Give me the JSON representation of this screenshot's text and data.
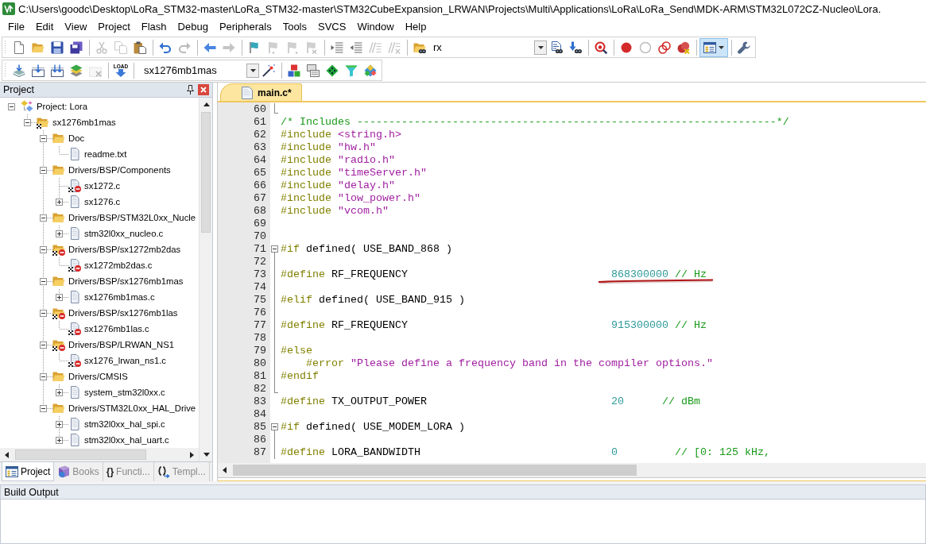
{
  "window": {
    "title": "C:\\Users\\goodc\\Desktop\\LoRa_STM32-master\\LoRa_STM32-master\\STM32CubeExpansion_LRWAN\\Projects\\Multi\\Applications\\LoRa\\LoRa_Send\\MDK-ARM\\STM32L072CZ-Nucleo\\Lora."
  },
  "menu": [
    "File",
    "Edit",
    "View",
    "Project",
    "Flash",
    "Debug",
    "Peripherals",
    "Tools",
    "SVCS",
    "Window",
    "Help"
  ],
  "toolbars": [
    {
      "items": [
        {
          "kind": "new",
          "disabled": false
        },
        {
          "kind": "open",
          "disabled": false
        },
        {
          "kind": "save",
          "disabled": false
        },
        {
          "kind": "save-all",
          "disabled": false
        },
        {
          "kind": "separator"
        },
        {
          "kind": "cut",
          "disabled": true
        },
        {
          "kind": "copy",
          "disabled": true
        },
        {
          "kind": "paste",
          "disabled": false
        },
        {
          "kind": "separator"
        },
        {
          "kind": "undo",
          "disabled": false
        },
        {
          "kind": "redo",
          "disabled": true
        },
        {
          "kind": "separator"
        },
        {
          "kind": "back",
          "disabled": false
        },
        {
          "kind": "forward",
          "disabled": true
        },
        {
          "kind": "separator"
        },
        {
          "kind": "bookmark",
          "disabled": false
        },
        {
          "kind": "bookmark-prev",
          "disabled": true
        },
        {
          "kind": "bookmark-next",
          "disabled": true
        },
        {
          "kind": "bookmark-clear",
          "disabled": true
        },
        {
          "kind": "separator"
        },
        {
          "kind": "indent",
          "disabled": false
        },
        {
          "kind": "unindent",
          "disabled": false
        },
        {
          "kind": "comment",
          "disabled": true
        },
        {
          "kind": "uncomment",
          "disabled": true
        },
        {
          "kind": "separator"
        },
        {
          "kind": "find-in-files",
          "disabled": false
        },
        {
          "kind": "find-combo",
          "value": "rx"
        },
        {
          "kind": "find",
          "disabled": false
        },
        {
          "kind": "find-incremental",
          "disabled": false
        },
        {
          "kind": "separator"
        },
        {
          "kind": "debug",
          "disabled": false
        },
        {
          "kind": "separator"
        },
        {
          "kind": "breakpoint",
          "disabled": false
        },
        {
          "kind": "breakpoint-disable",
          "disabled": false
        },
        {
          "kind": "breakpoints-disable-all",
          "disabled": false
        },
        {
          "kind": "breakpoints-kill",
          "disabled": false
        },
        {
          "kind": "separator"
        },
        {
          "kind": "window-layout",
          "pressed": true
        },
        {
          "kind": "separator"
        },
        {
          "kind": "configure",
          "disabled": false
        }
      ]
    },
    {
      "items": [
        {
          "kind": "translate",
          "disabled": false
        },
        {
          "kind": "build",
          "disabled": false
        },
        {
          "kind": "rebuild",
          "disabled": false
        },
        {
          "kind": "batch-build",
          "disabled": false
        },
        {
          "kind": "stop-build",
          "disabled": true
        },
        {
          "kind": "separator"
        },
        {
          "kind": "load",
          "label": "LOAD"
        },
        {
          "kind": "separator"
        },
        {
          "kind": "target-combo",
          "value": "sx1276mb1mas"
        },
        {
          "kind": "target-options",
          "disabled": false
        },
        {
          "kind": "separator"
        },
        {
          "kind": "components",
          "disabled": false
        },
        {
          "kind": "environment",
          "disabled": false
        },
        {
          "kind": "packs",
          "disabled": false
        },
        {
          "kind": "filter",
          "disabled": false
        },
        {
          "kind": "pack-installer",
          "disabled": false
        }
      ]
    }
  ],
  "project_panel": {
    "title": "Project",
    "tree": [
      {
        "kind": "project",
        "label": "Project: Lora",
        "expanded": true,
        "children": [
          {
            "kind": "target",
            "label": "sx1276mb1mas",
            "expanded": true,
            "children": [
              {
                "kind": "group",
                "label": "Doc",
                "expanded": true,
                "excluded": false,
                "children": [
                  {
                    "kind": "file",
                    "label": "readme.txt",
                    "excluded": false
                  }
                ]
              },
              {
                "kind": "group",
                "label": "Drivers/BSP/Components",
                "expanded": true,
                "excluded": false,
                "children": [
                  {
                    "kind": "file",
                    "label": "sx1272.c",
                    "excluded": true
                  },
                  {
                    "kind": "file",
                    "label": "sx1276.c",
                    "expanded": false,
                    "excluded": false
                  }
                ]
              },
              {
                "kind": "group",
                "label": "Drivers/BSP/STM32L0xx_Nucle",
                "expanded": true,
                "excluded": false,
                "children": [
                  {
                    "kind": "file",
                    "label": "stm32l0xx_nucleo.c",
                    "expanded": false,
                    "excluded": false
                  }
                ]
              },
              {
                "kind": "group",
                "label": "Drivers/BSP/sx1272mb2das",
                "expanded": true,
                "excluded": true,
                "children": [
                  {
                    "kind": "file",
                    "label": "sx1272mb2das.c",
                    "excluded": true
                  }
                ]
              },
              {
                "kind": "group",
                "label": "Drivers/BSP/sx1276mb1mas",
                "expanded": true,
                "excluded": false,
                "children": [
                  {
                    "kind": "file",
                    "label": "sx1276mb1mas.c",
                    "expanded": false,
                    "excluded": false
                  }
                ]
              },
              {
                "kind": "group",
                "label": "Drivers/BSP/sx1276mb1las",
                "expanded": true,
                "excluded": true,
                "children": [
                  {
                    "kind": "file",
                    "label": "sx1276mb1las.c",
                    "excluded": true
                  }
                ]
              },
              {
                "kind": "group",
                "label": "Drivers/BSP/LRWAN_NS1",
                "expanded": true,
                "excluded": true,
                "children": [
                  {
                    "kind": "file",
                    "label": "sx1276_lrwan_ns1.c",
                    "excluded": true
                  }
                ]
              },
              {
                "kind": "group",
                "label": "Drivers/CMSIS",
                "expanded": true,
                "excluded": false,
                "children": [
                  {
                    "kind": "file",
                    "label": "system_stm32l0xx.c",
                    "expanded": false,
                    "excluded": false
                  }
                ]
              },
              {
                "kind": "group",
                "label": "Drivers/STM32L0xx_HAL_Drive",
                "expanded": true,
                "excluded": false,
                "children": [
                  {
                    "kind": "file",
                    "label": "stm32l0xx_hal_spi.c",
                    "expanded": false,
                    "excluded": false
                  },
                  {
                    "kind": "file",
                    "label": "stm32l0xx_hal_uart.c",
                    "expanded": false,
                    "excluded": false
                  }
                ]
              }
            ]
          }
        ]
      }
    ],
    "tabs": [
      {
        "kind": "project",
        "label": "Project",
        "selected": true
      },
      {
        "kind": "books",
        "label": "Books",
        "selected": false
      },
      {
        "kind": "functions",
        "glyph": "{}",
        "label": "Functi...",
        "selected": false
      },
      {
        "kind": "templates",
        "label": "Templ...",
        "selected": false
      }
    ]
  },
  "editor": {
    "tabs": [
      {
        "label": "main.c*",
        "selected": true
      }
    ],
    "lines": [
      {
        "number": "60",
        "kind": "fold-end"
      },
      {
        "number": "61",
        "kind": "plain",
        "segments": [
          {
            "kind": "comment",
            "text": "/* Includes ------------------------------------------------------------------*/"
          }
        ]
      },
      {
        "number": "62",
        "kind": "plain",
        "segments": [
          {
            "kind": "directive",
            "text": "#include"
          },
          {
            "kind": "string",
            "text": " <string.h>"
          }
        ]
      },
      {
        "number": "63",
        "kind": "plain",
        "segments": [
          {
            "kind": "directive",
            "text": "#include"
          },
          {
            "kind": "string",
            "text": " \"hw.h\""
          }
        ]
      },
      {
        "number": "64",
        "kind": "plain",
        "segments": [
          {
            "kind": "directive",
            "text": "#include"
          },
          {
            "kind": "string",
            "text": " \"radio.h\""
          }
        ]
      },
      {
        "number": "65",
        "kind": "plain",
        "segments": [
          {
            "kind": "directive",
            "text": "#include"
          },
          {
            "kind": "string",
            "text": " \"timeServer.h\""
          }
        ]
      },
      {
        "number": "66",
        "kind": "plain",
        "segments": [
          {
            "kind": "directive",
            "text": "#include"
          },
          {
            "kind": "string",
            "text": " \"delay.h\""
          }
        ]
      },
      {
        "number": "67",
        "kind": "plain",
        "segments": [
          {
            "kind": "directive",
            "text": "#include"
          },
          {
            "kind": "string",
            "text": " \"low_power.h\""
          }
        ]
      },
      {
        "number": "68",
        "kind": "plain",
        "segments": [
          {
            "kind": "directive",
            "text": "#include"
          },
          {
            "kind": "string",
            "text": " \"vcom.h\""
          }
        ]
      },
      {
        "number": "69",
        "kind": "plain"
      },
      {
        "number": "70",
        "kind": "plain"
      },
      {
        "number": "71",
        "kind": "fold-start",
        "segments": [
          {
            "kind": "directive",
            "text": "#if"
          },
          {
            "kind": "plain",
            "text": " defined( USE_BAND_868 )"
          }
        ]
      },
      {
        "number": "72",
        "kind": "fold-inside"
      },
      {
        "number": "73",
        "kind": "fold-inside",
        "segments": [
          {
            "kind": "directive",
            "text": "#define"
          },
          {
            "kind": "plain",
            "text": " RF_FREQUENCY                                "
          }
        ],
        "underlined_segments": [
          {
            "kind": "number",
            "text": "868300000"
          },
          {
            "kind": "comment",
            "text": " // Hz"
          }
        ]
      },
      {
        "number": "74",
        "kind": "fold-inside"
      },
      {
        "number": "75",
        "kind": "fold-inside",
        "segments": [
          {
            "kind": "directive",
            "text": "#elif"
          },
          {
            "kind": "plain",
            "text": " defined( USE_BAND_915 )"
          }
        ]
      },
      {
        "number": "76",
        "kind": "fold-inside"
      },
      {
        "number": "77",
        "kind": "fold-inside",
        "segments": [
          {
            "kind": "directive",
            "text": "#define"
          },
          {
            "kind": "plain",
            "text": " RF_FREQUENCY                                "
          },
          {
            "kind": "number",
            "text": "915300000"
          },
          {
            "kind": "comment",
            "text": " // Hz"
          }
        ]
      },
      {
        "number": "78",
        "kind": "fold-inside"
      },
      {
        "number": "79",
        "kind": "fold-inside",
        "segments": [
          {
            "kind": "directive",
            "text": "#else"
          }
        ]
      },
      {
        "number": "80",
        "kind": "fold-inside",
        "segments": [
          {
            "kind": "directive",
            "text": "    #error"
          },
          {
            "kind": "string",
            "text": " \"Please define a frequency band in the compiler options.\""
          }
        ]
      },
      {
        "number": "81",
        "kind": "fold-inside",
        "segments": [
          {
            "kind": "directive",
            "text": "#endif"
          }
        ]
      },
      {
        "number": "82",
        "kind": "fold-end"
      },
      {
        "number": "83",
        "kind": "plain",
        "segments": [
          {
            "kind": "directive",
            "text": "#define"
          },
          {
            "kind": "plain",
            "text": " TX_OUTPUT_POWER                             "
          },
          {
            "kind": "number",
            "text": "20"
          },
          {
            "kind": "comment",
            "text": "      // dBm"
          }
        ]
      },
      {
        "number": "84",
        "kind": "plain"
      },
      {
        "number": "85",
        "kind": "fold-start",
        "segments": [
          {
            "kind": "directive",
            "text": "#if"
          },
          {
            "kind": "plain",
            "text": " defined( USE_MODEM_LORA )"
          }
        ]
      },
      {
        "number": "86",
        "kind": "fold-inside"
      },
      {
        "number": "87",
        "kind": "fold-inside",
        "segments": [
          {
            "kind": "directive",
            "text": "#define"
          },
          {
            "kind": "plain",
            "text": " LORA_BANDWIDTH                              "
          },
          {
            "kind": "number",
            "text": "0"
          },
          {
            "kind": "comment",
            "text": "         // [0: 125 kHz,"
          }
        ]
      }
    ]
  },
  "build_output": {
    "title": "Build Output"
  }
}
